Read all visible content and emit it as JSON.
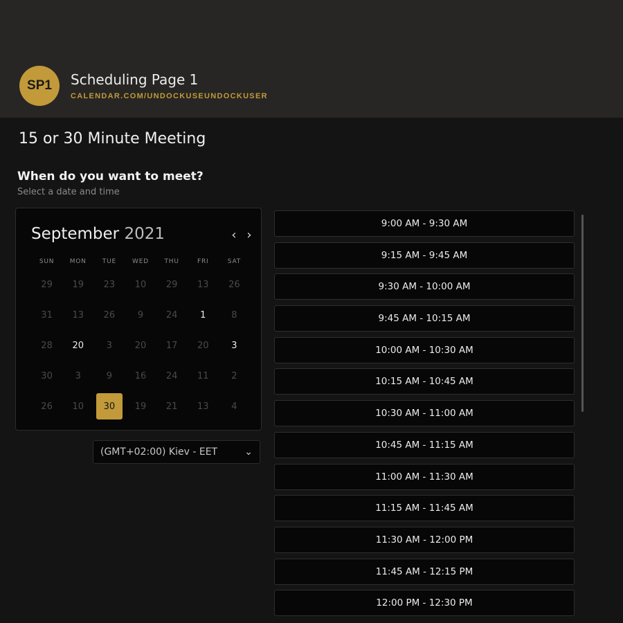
{
  "header": {
    "avatar_initials": "SP1",
    "page_name": "Scheduling Page 1",
    "url": "CALENDAR.COM/UNDOCKUSEUNDOCKUSER"
  },
  "meeting": {
    "title": "15 or 30 Minute Meeting",
    "question": "When do you want to meet?",
    "hint": "Select a date and time"
  },
  "calendar": {
    "month": "September",
    "year": "2021",
    "prev_icon": "chevron-left-icon",
    "next_icon": "chevron-right-icon",
    "weekdays": [
      "SUN",
      "MON",
      "TUE",
      "WED",
      "THU",
      "FRI",
      "SAT"
    ],
    "days": [
      {
        "label": "29",
        "active": false
      },
      {
        "label": "19",
        "active": false
      },
      {
        "label": "23",
        "active": false
      },
      {
        "label": "10",
        "active": false
      },
      {
        "label": "29",
        "active": false
      },
      {
        "label": "13",
        "active": false
      },
      {
        "label": "26",
        "active": false
      },
      {
        "label": "31",
        "active": false
      },
      {
        "label": "13",
        "active": false
      },
      {
        "label": "26",
        "active": false
      },
      {
        "label": "9",
        "active": false
      },
      {
        "label": "24",
        "active": false
      },
      {
        "label": "1",
        "active": true
      },
      {
        "label": "8",
        "active": false
      },
      {
        "label": "28",
        "active": false
      },
      {
        "label": "20",
        "active": true
      },
      {
        "label": "3",
        "active": false
      },
      {
        "label": "20",
        "active": false
      },
      {
        "label": "17",
        "active": false
      },
      {
        "label": "20",
        "active": false
      },
      {
        "label": "3",
        "active": true
      },
      {
        "label": "30",
        "active": false
      },
      {
        "label": "3",
        "active": false
      },
      {
        "label": "9",
        "active": false
      },
      {
        "label": "16",
        "active": false
      },
      {
        "label": "24",
        "active": false
      },
      {
        "label": "11",
        "active": false
      },
      {
        "label": "2",
        "active": false
      },
      {
        "label": "26",
        "active": false
      },
      {
        "label": "10",
        "active": false
      },
      {
        "label": "30",
        "active": true,
        "selected": true
      },
      {
        "label": "19",
        "active": false
      },
      {
        "label": "21",
        "active": false
      },
      {
        "label": "13",
        "active": false
      },
      {
        "label": "4",
        "active": false
      }
    ],
    "selected_color": "#c29a3a"
  },
  "timezone": {
    "value": "(GMT+02:00) Kiev - EET",
    "icon": "chevron-down-icon"
  },
  "slots": [
    "9:00 AM - 9:30 AM",
    "9:15 AM - 9:45 AM",
    "9:30 AM - 10:00 AM",
    "9:45 AM - 10:15 AM",
    "10:00 AM - 10:30 AM",
    "10:15 AM - 10:45 AM",
    "10:30 AM - 11:00 AM",
    "10:45 AM - 11:15 AM",
    "11:00 AM - 11:30 AM",
    "11:15 AM - 11:45 AM",
    "11:30 AM - 12:00 PM",
    "11:45 AM - 12:15 PM",
    "12:00 PM - 12:30 PM"
  ],
  "colors": {
    "accent": "#c29a3a",
    "background": "#141414",
    "header_band": "#272624"
  }
}
